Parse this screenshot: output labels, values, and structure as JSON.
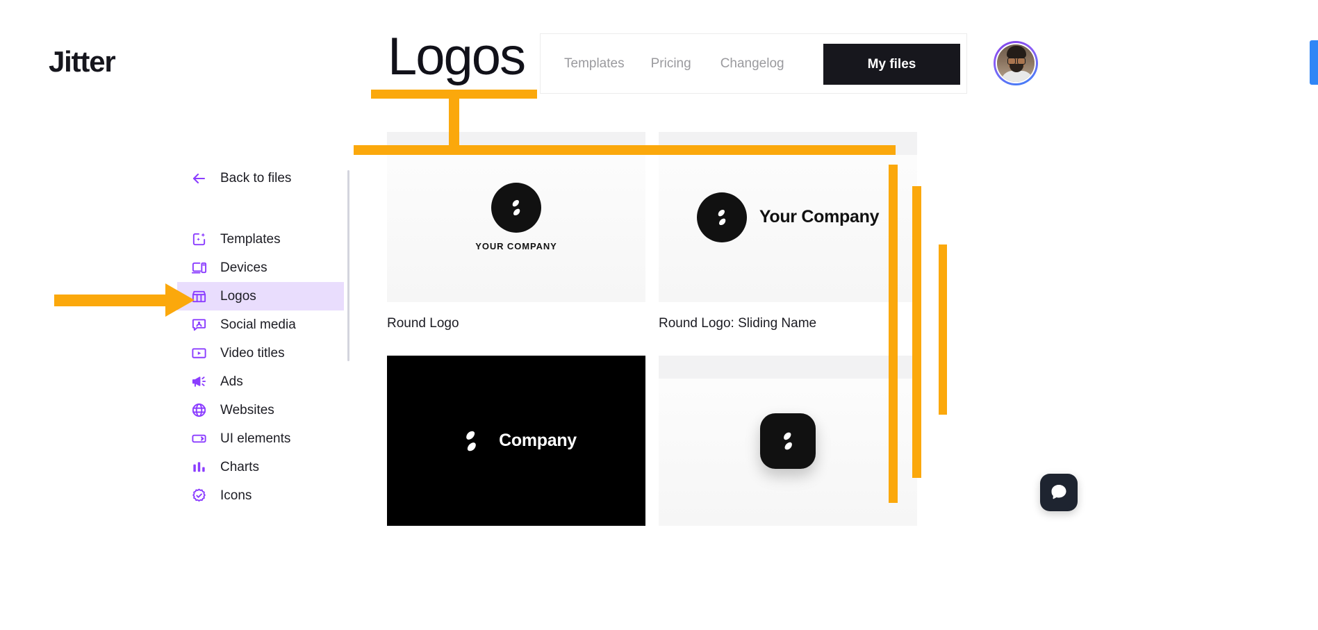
{
  "brand": {
    "name": "Jitter"
  },
  "overlay": {
    "title": "Logos"
  },
  "nav": {
    "links": [
      {
        "label": "Templates",
        "icon": "nav-link-icon"
      },
      {
        "label": "Pricing",
        "icon": "nav-link-icon"
      },
      {
        "label": "Changelog",
        "icon": "nav-link-icon"
      }
    ],
    "cta": {
      "label": "My files"
    },
    "avatar": {
      "alt": "user-avatar"
    }
  },
  "sidebar": {
    "back": {
      "label": "Back to files",
      "icon": "arrow-left-icon"
    },
    "items": [
      {
        "label": "Templates",
        "icon": "sparkle-frame-icon",
        "active": false
      },
      {
        "label": "Devices",
        "icon": "devices-icon",
        "active": false
      },
      {
        "label": "Logos",
        "icon": "storefront-icon",
        "active": true
      },
      {
        "label": "Social media",
        "icon": "chat-person-icon",
        "active": false
      },
      {
        "label": "Video titles",
        "icon": "video-play-icon",
        "active": false
      },
      {
        "label": "Ads",
        "icon": "megaphone-icon",
        "active": false
      },
      {
        "label": "Websites",
        "icon": "globe-icon",
        "active": false
      },
      {
        "label": "UI elements",
        "icon": "ui-card-icon",
        "active": false
      },
      {
        "label": "Charts",
        "icon": "bar-chart-icon",
        "active": false
      },
      {
        "label": "Icons",
        "icon": "badge-check-icon",
        "active": false
      }
    ]
  },
  "gallery": {
    "cards": [
      {
        "title": "Round Logo",
        "mark": "circle",
        "wordmark": "YOUR COMPANY",
        "layout": "stacked",
        "dark": false
      },
      {
        "title": "Round Logo: Sliding Name",
        "mark": "circle",
        "wordmark": "Your Company",
        "layout": "inline",
        "dark": false
      },
      {
        "title": "",
        "mark": "plain",
        "wordmark": "Company",
        "layout": "inline",
        "dark": true
      },
      {
        "title": "",
        "mark": "rounded",
        "wordmark": "",
        "layout": "markonly",
        "dark": false
      }
    ]
  },
  "annotations": {
    "color": "#FBA80C",
    "arrow_target": "Logos",
    "shapes": [
      "underline-logos",
      "vertical-stub",
      "horizontal-rule",
      "vbar-1",
      "vbar-2",
      "vbar-3",
      "left-arrow"
    ]
  },
  "widgets": {
    "intercom": {
      "label": "intercom-launcher"
    }
  },
  "colors": {
    "accent_purple": "#8B3DFF",
    "active_bg": "#E9DDFD",
    "annotation_orange": "#FBA80C",
    "dark": "#17171D",
    "blue_bar": "#2F86F6"
  }
}
